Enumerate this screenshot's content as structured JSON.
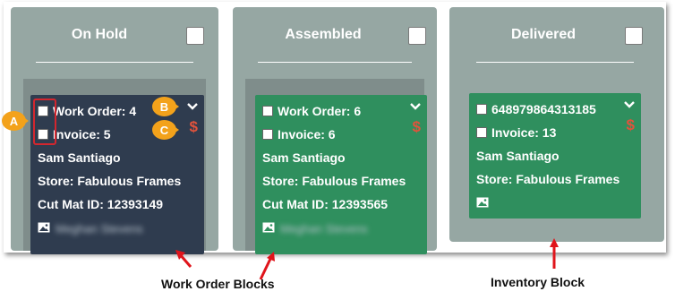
{
  "columns": [
    {
      "title": "On Hold"
    },
    {
      "title": "Assembled"
    },
    {
      "title": "Delivered"
    }
  ],
  "cards": {
    "on_hold": {
      "work_order": "Work Order: 4",
      "invoice": "Invoice: 5",
      "customer": "Sam Santiago",
      "store": "Store: Fabulous Frames",
      "cut_mat": "Cut Mat ID: 12393149",
      "assignee": "Meghan Stevens",
      "price_symbol": "$"
    },
    "assembled": {
      "work_order": "Work Order: 6",
      "invoice": "Invoice: 6",
      "customer": "Sam Santiago",
      "store": "Store: Fabulous Frames",
      "cut_mat": "Cut Mat ID: 12393565",
      "assignee": "Meghan Stevens",
      "price_symbol": "$"
    },
    "delivered": {
      "item_id": "648979864313185",
      "invoice": "Invoice: 13",
      "customer": "Sam Santiago",
      "store": "Store: Fabulous Frames",
      "price_symbol": "$"
    }
  },
  "annotations": {
    "marker_a": "A",
    "marker_b": "B",
    "marker_c": "C",
    "work_order_blocks": "Work Order Blocks",
    "inventory_block": "Inventory Block"
  },
  "colors": {
    "column_bg": "#96a7a3",
    "card_navy": "#2f3c4f",
    "card_green": "#2f8f5e",
    "accent_red": "#d3262e",
    "marker_orange": "#f3a21b"
  }
}
